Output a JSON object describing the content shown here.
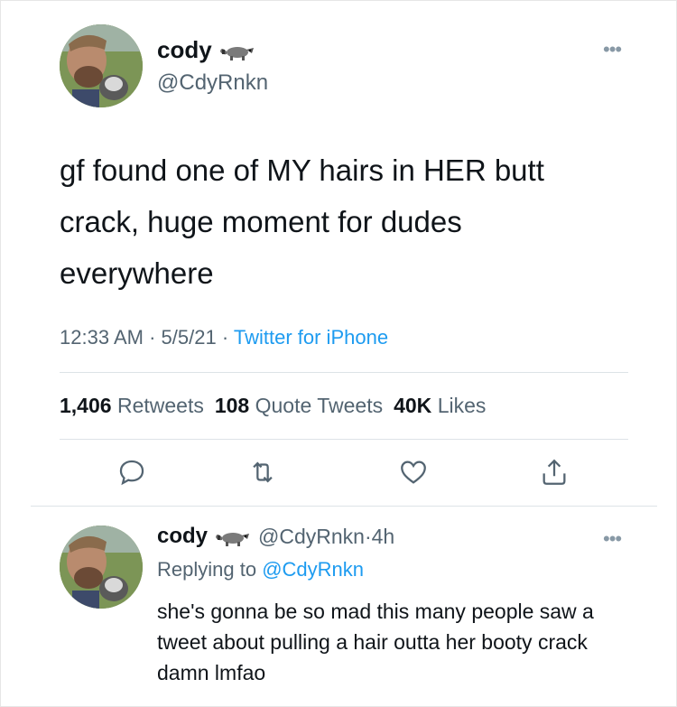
{
  "tweet": {
    "display_name": "cody",
    "handle": "@CdyRnkn",
    "text": "gf found one of MY hairs in HER butt crack, huge moment for dudes everywhere",
    "time": "12:33 AM",
    "date": "5/5/21",
    "separator": "·",
    "source": "Twitter for iPhone",
    "stats": {
      "retweets_count": "1,406",
      "retweets_label": "Retweets",
      "quotes_count": "108",
      "quotes_label": "Quote Tweets",
      "likes_count": "40K",
      "likes_label": "Likes"
    }
  },
  "reply": {
    "display_name": "cody",
    "handle": "@CdyRnkn",
    "age": "4h",
    "replying_prefix": "Replying to",
    "replying_to": "@CdyRnkn",
    "text": "she's gonna be so mad this many people saw a tweet about pulling a hair outta her booty crack damn lmfao"
  },
  "icons": {
    "more": "more-icon",
    "reply": "reply-icon",
    "retweet": "retweet-icon",
    "like": "heart-icon",
    "share": "share-icon",
    "name_emoji": "raccoon-icon"
  },
  "colors": {
    "link": "#1d9bf0",
    "secondary_text": "#536471",
    "primary_text": "#0f1419"
  }
}
